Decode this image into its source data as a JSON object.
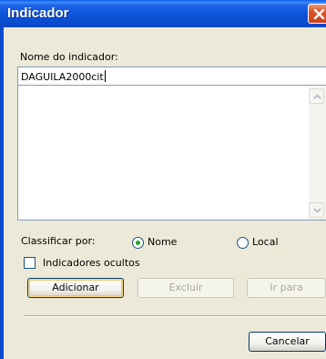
{
  "window": {
    "title": "Indicador"
  },
  "form": {
    "name_label": "Nome do indicador:",
    "name_value": "DAGUILA2000cit",
    "sort_label": "Classificar por:",
    "sort_options": [
      {
        "label": "Nome",
        "selected": true
      },
      {
        "label": "Local",
        "selected": false
      }
    ],
    "hidden_label": "Indicadores ocultos",
    "hidden_checked": false,
    "bookmarks": []
  },
  "buttons": {
    "add": "Adicionar",
    "delete": "Excluir",
    "goto": "Ir para",
    "cancel": "Cancelar"
  },
  "icons": {
    "close": "close-icon",
    "scroll_up": "chevron-up-icon",
    "scroll_down": "chevron-down-icon"
  },
  "colors": {
    "titlebar": "#0c54d9",
    "close": "#e0562c",
    "radio_dot": "#21a121",
    "disabled_text": "#aca899"
  }
}
